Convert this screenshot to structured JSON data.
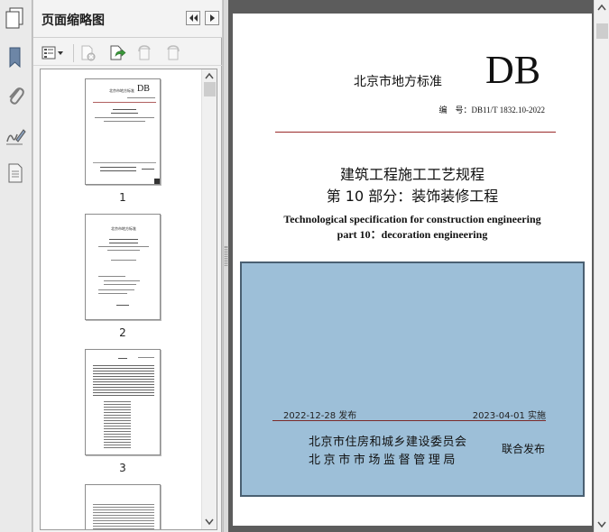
{
  "panel": {
    "title": "页面缩略图",
    "thumbnails": [
      {
        "page_label": "1",
        "header": "北京市地方标准",
        "mark": "DB"
      },
      {
        "page_label": "2",
        "header": "北京市地方标准"
      },
      {
        "page_label": "3"
      },
      {
        "page_label": ""
      }
    ]
  },
  "document": {
    "standard_label": "北京市地方标准",
    "db_mark": "DB",
    "standard_number": "编　号：DB11/T 1832.10-2022",
    "title_cn_line1": "建筑工程施工工艺规程",
    "title_cn_line2": "第 10 部分：装饰装修工程",
    "title_en_line1": "Technological specification for construction engineering",
    "title_en_line2": "part 10：decoration engineering",
    "issue_date": "2022-12-28 发布",
    "implement_date": "2023-04-01 实施",
    "issuer_1": "北京市住房和城乡建设委员会",
    "issuer_2": "北京市市场监督管理局",
    "joint_issue": "联合发布"
  },
  "colors": {
    "cover_box": "#9dbfd8",
    "rule_red": "#9a2a2a",
    "viewer_bg": "#5c5c5c",
    "panel_bg": "#f3f3f3"
  },
  "icons": {
    "rail": [
      "bookmark-icon",
      "paperclip-icon",
      "signature-icon",
      "page-icon"
    ],
    "toolbar": [
      "options-menu-icon",
      "delete-page-icon",
      "insert-page-icon",
      "rotate-left-icon",
      "rotate-right-icon"
    ]
  }
}
